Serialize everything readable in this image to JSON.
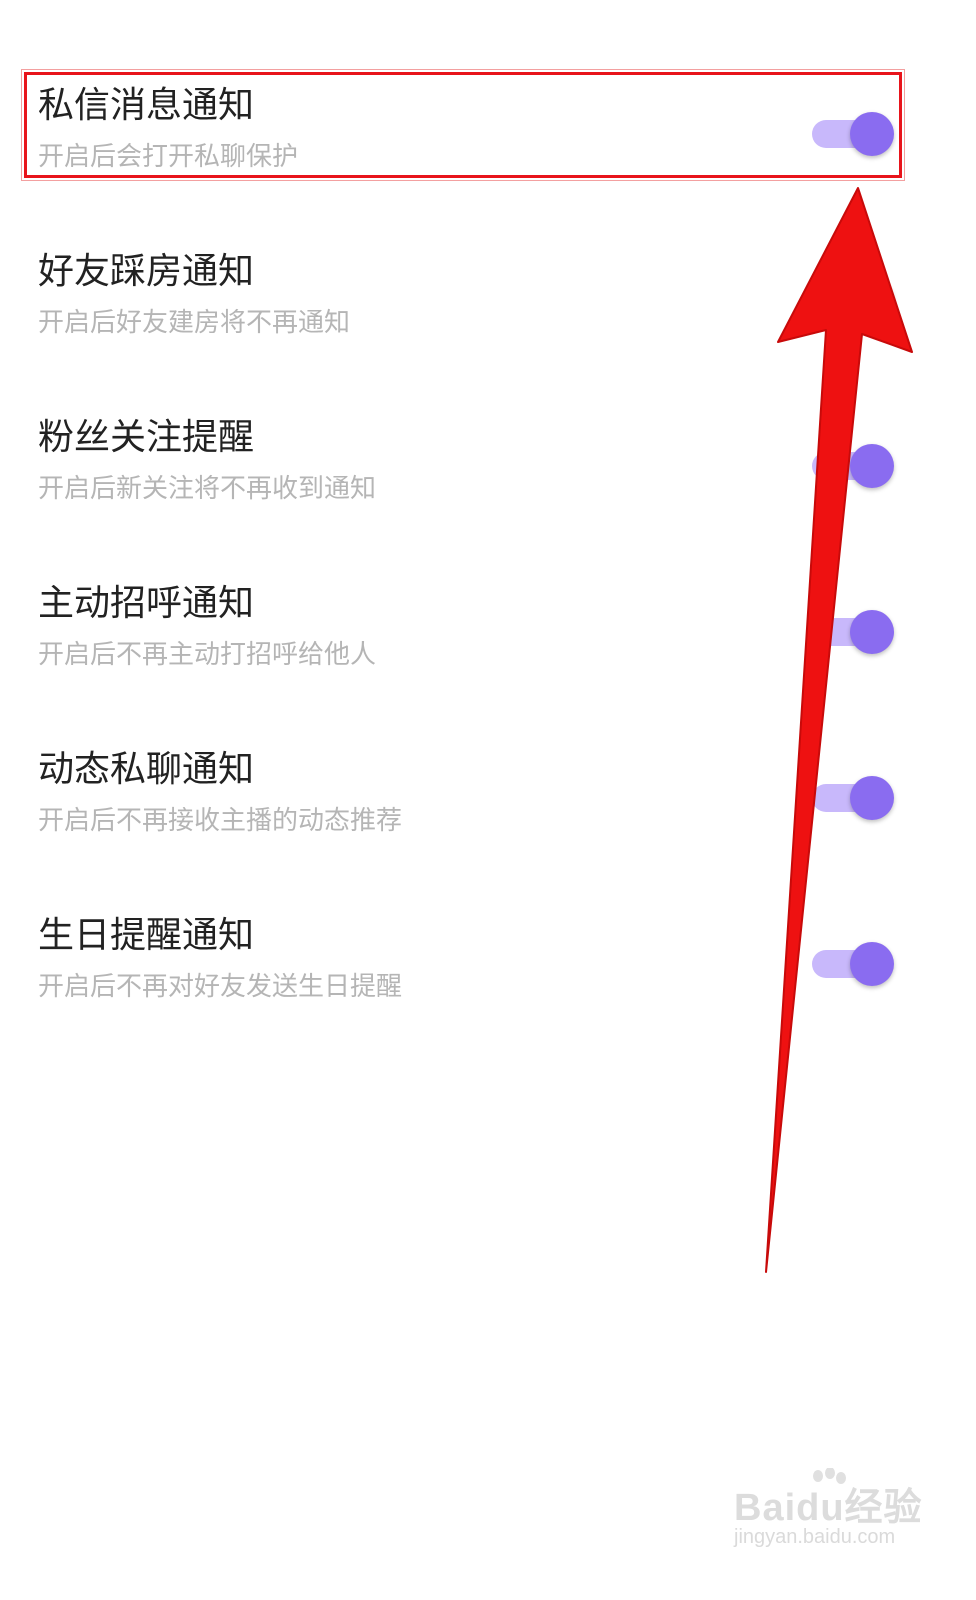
{
  "settings": {
    "items": [
      {
        "title": "私信消息通知",
        "subtitle": "开启后会打开私聊保护",
        "enabled": true
      },
      {
        "title": "好友踩房通知",
        "subtitle": "开启后好友建房将不再通知",
        "enabled": true
      },
      {
        "title": "粉丝关注提醒",
        "subtitle": "开启后新关注将不再收到通知",
        "enabled": true
      },
      {
        "title": "主动招呼通知",
        "subtitle": "开启后不再主动打招呼给他人",
        "enabled": true
      },
      {
        "title": "动态私聊通知",
        "subtitle": "开启后不再接收主播的动态推荐",
        "enabled": true
      },
      {
        "title": "生日提醒通知",
        "subtitle": "开启后不再对好友发送生日提醒",
        "enabled": true
      }
    ]
  },
  "colors": {
    "toggle_track": "#c8b8fb",
    "toggle_knob": "#8a6cf0",
    "annotation_red": "#ee1111",
    "title_text": "#222222",
    "subtitle_text": "#b5b5b5"
  },
  "watermark": {
    "brand": "Baidu经验",
    "site": "jingyan.baidu.com"
  }
}
